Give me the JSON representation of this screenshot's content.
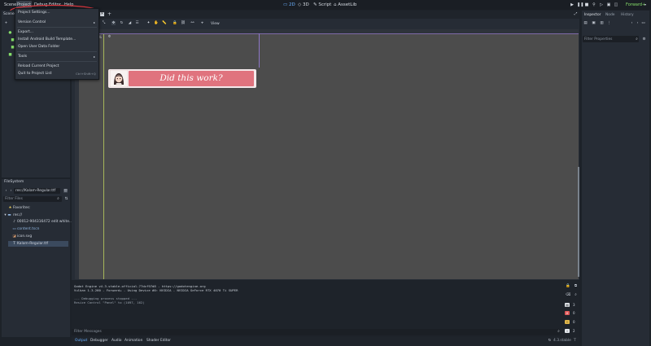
{
  "menubar": {
    "items": [
      "Scene",
      "Project",
      "Debug",
      "Editor",
      "Help"
    ]
  },
  "workspaces": {
    "tabs": [
      {
        "label": "2D",
        "icon": "2d-icon",
        "active": true
      },
      {
        "label": "3D",
        "icon": "3d-icon",
        "active": false
      },
      {
        "label": "Script",
        "icon": "script-icon",
        "active": false
      },
      {
        "label": "AssetLib",
        "icon": "assetlib-icon",
        "active": false
      }
    ]
  },
  "renderer": {
    "label": "Forward+"
  },
  "scene_dock": {
    "tab": "Scene"
  },
  "scene_tabs": {
    "add_label": "+"
  },
  "project_menu": {
    "items": [
      {
        "label": "Project Settings...",
        "shortcut": ""
      },
      {
        "label": "Version Control",
        "shortcut": "",
        "submenu": true
      },
      {
        "label": "Export...",
        "shortcut": ""
      },
      {
        "label": "Install Android Build Template...",
        "shortcut": ""
      },
      {
        "label": "Open User Data Folder",
        "shortcut": ""
      },
      {
        "label": "Tools",
        "shortcut": "",
        "submenu": true
      },
      {
        "label": "Reload Current Project",
        "shortcut": ""
      },
      {
        "label": "Quit to Project List",
        "shortcut": "Ctrl+Shift+Q"
      }
    ]
  },
  "toolbar2d": {
    "view_label": "View",
    "zoom_label": "%"
  },
  "canvas": {
    "dialog_text": "Did this work?",
    "accent": "#e0737e"
  },
  "filesystem": {
    "tab": "FileSystem",
    "path": "res://Kalam-Regular.ttf",
    "filter_placeholder": "Filter Files",
    "items": [
      {
        "label": "Favorites:",
        "icon": "star-icon"
      },
      {
        "label": "res://",
        "icon": "folder-icon"
      },
      {
        "label": "00012-904316472 edit white...",
        "icon": "music-icon"
      },
      {
        "label": "content.tscn",
        "icon": "scene-icon"
      },
      {
        "label": "icon.svg",
        "icon": "image-icon"
      },
      {
        "label": "Kalam-Regular.ttf",
        "icon": "font-icon",
        "selected": true
      }
    ]
  },
  "inspector": {
    "tabs": [
      "Inspector",
      "Node",
      "History"
    ],
    "filter_placeholder": "Filter Properties"
  },
  "output": {
    "lines": [
      "Godot Engine v4.3.stable.official.77dcf97d8 - https://godotengine.org",
      "Vulkan 1.3.260 - Forward+ - Using Device #0: NVIDIA - NVIDIA GeForce RTX 4070 Ti SUPER",
      "",
      "--- Debugging process stopped ---",
      "Resize Control \"Panel\" to (1097, 162)"
    ],
    "filter_placeholder": "Filter Messages",
    "counts": {
      "log": "3",
      "errors": "0",
      "warnings": "0",
      "info": "2"
    }
  },
  "bottom_tabs": [
    "Output",
    "Debugger",
    "Audio",
    "Animation",
    "Shader Editor"
  ],
  "version": "4.3.stable"
}
